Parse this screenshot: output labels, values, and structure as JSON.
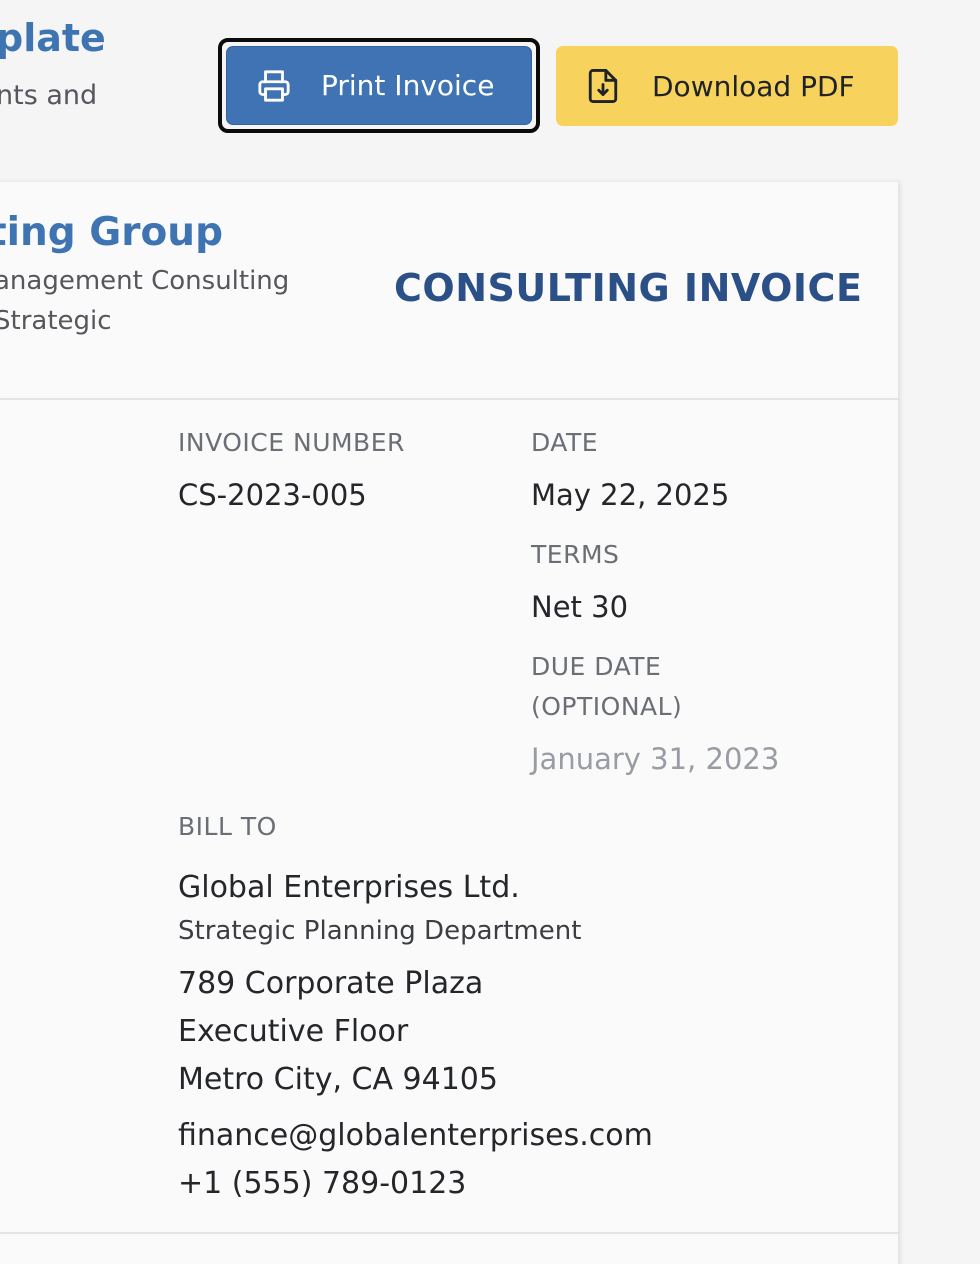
{
  "header": {
    "title": "plate",
    "subtitle": "nts and"
  },
  "toolbar": {
    "print_label": "Print Invoice",
    "pdf_label": "Download PDF"
  },
  "company": {
    "name": "ting Group",
    "tagline_1": "anagement Consulting",
    "tagline_2": "Strategic"
  },
  "invoice": {
    "title": "CONSULTING INVOICE",
    "number_label": "INVOICE NUMBER",
    "number_value": "CS-2023-005",
    "date_label": "DATE",
    "date_value": "May 22, 2025",
    "terms_label": "TERMS",
    "terms_value": "Net 30",
    "due_label_1": "DUE DATE",
    "due_label_2": "(OPTIONAL)",
    "due_placeholder": "January 31, 2023"
  },
  "bill_to": {
    "label": "BILL TO",
    "company": "Global Enterprises Ltd.",
    "department": "Strategic Planning Department",
    "address_1": "789 Corporate Plaza",
    "address_2": "Executive Floor",
    "city_line": "Metro City, CA 94105",
    "email": "finance@globalenterprises.com",
    "phone": "+1 (555) 789-0123"
  },
  "colors": {
    "accent_blue": "#3d74b1",
    "title_navy": "#2b5087",
    "pdf_yellow": "#f7d35e"
  }
}
